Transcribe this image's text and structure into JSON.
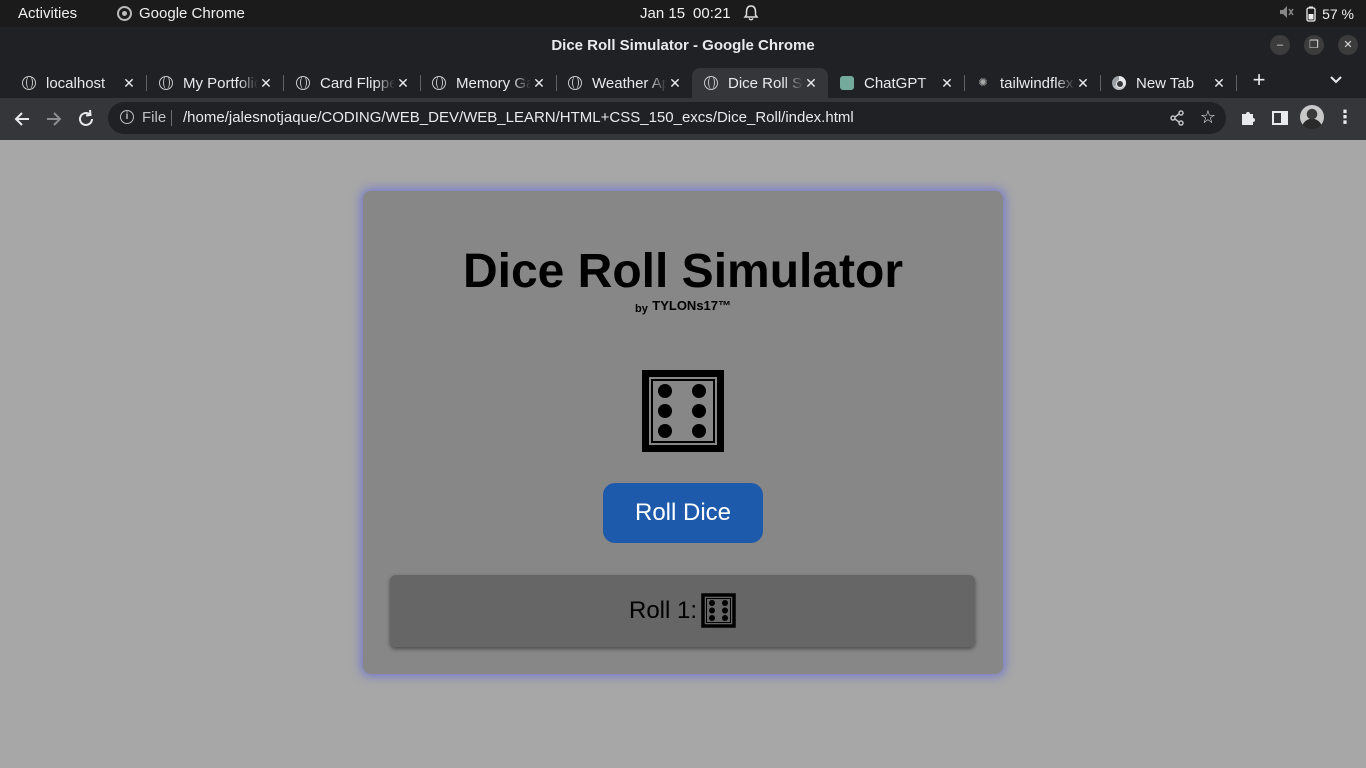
{
  "system_bar": {
    "activities": "Activities",
    "app_name": "Google Chrome",
    "date": "Jan 15",
    "time": "00:21",
    "battery": "57 %"
  },
  "window": {
    "title": "Dice Roll Simulator - Google Chrome"
  },
  "tabs": [
    {
      "label": "localhost",
      "icon": "globe-icon",
      "active": false
    },
    {
      "label": "My Portfolio",
      "icon": "globe-icon",
      "active": false
    },
    {
      "label": "Card Flipper",
      "icon": "globe-icon",
      "active": false
    },
    {
      "label": "Memory Game",
      "icon": "globe-icon",
      "active": false
    },
    {
      "label": "Weather App",
      "icon": "globe-icon",
      "active": false
    },
    {
      "label": "Dice Roll Simulator",
      "icon": "globe-icon",
      "active": true
    },
    {
      "label": "ChatGPT",
      "icon": "chatgpt-icon",
      "active": false
    },
    {
      "label": "tailwindflex",
      "icon": "tailwind-icon",
      "active": false
    },
    {
      "label": "New Tab",
      "icon": "chrome-icon",
      "active": false
    }
  ],
  "toolbar": {
    "scheme": "File",
    "url": "/home/jalesnotjaque/CODING/WEB_DEV/WEB_LEARN/HTML+CSS_150_excs/Dice_Roll/index.html"
  },
  "page": {
    "title": "Dice Roll Simulator",
    "by": "by",
    "author": "TYLONs17™",
    "current_face": "⚅",
    "button_label": "Roll Dice",
    "history": [
      {
        "label": "Roll 1:",
        "face": "⚅"
      }
    ]
  },
  "colors": {
    "page_bg": "#a7a7a7",
    "card_bg": "#878787",
    "card_glow": "#4650f0",
    "button_bg": "#1d5aab",
    "history_bg": "#666666"
  }
}
